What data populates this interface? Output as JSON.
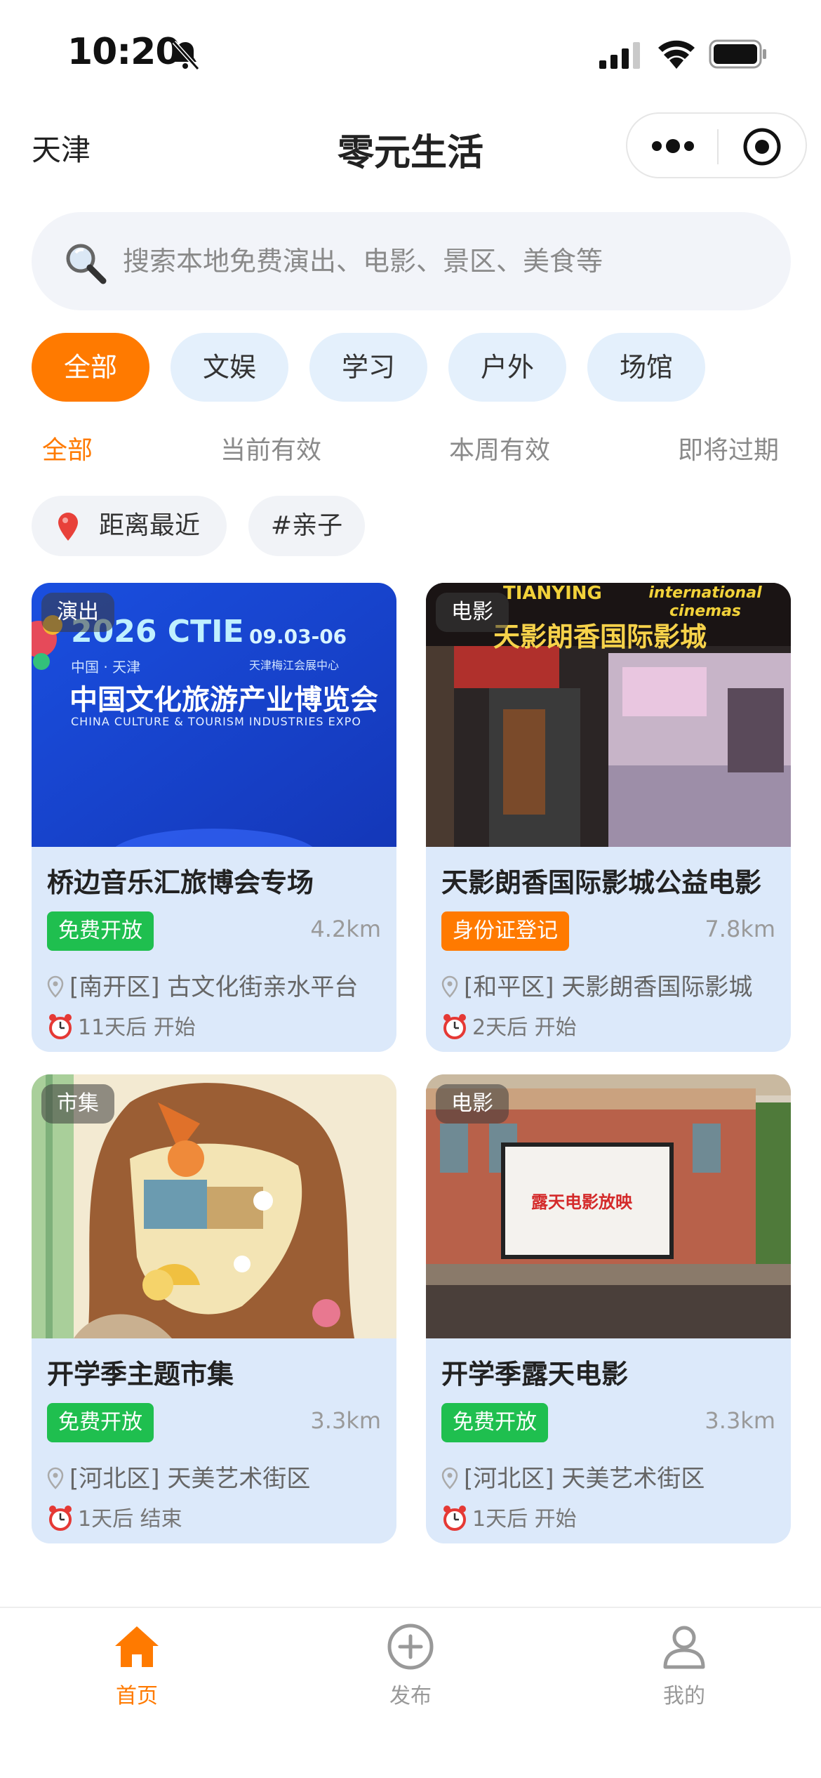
{
  "status_bar": {
    "time": "10:20"
  },
  "nav": {
    "city": "天津",
    "title": "零元生活"
  },
  "search": {
    "placeholder": "搜索本地免费演出、电影、景区、美食等"
  },
  "categories": [
    "全部",
    "文娱",
    "学习",
    "户外",
    "场馆"
  ],
  "time_filters": [
    "全部",
    "当前有效",
    "本周有效",
    "即将过期"
  ],
  "tags": {
    "nearest": "距离最近",
    "family": "#亲子"
  },
  "cards": [
    {
      "badge": "演出",
      "title": "桥边音乐汇旅博会专场",
      "pill": "免费开放",
      "pill_color": "#1fbf4f",
      "distance": "4.2km",
      "location": "[南开区] 古文化街亲水平台",
      "time": "11天后 开始",
      "image": {
        "year_text": "2026 CTIE",
        "date_text": "09.03-06",
        "sub_text": "中国 · 天津",
        "venue_text": "天津梅江会展中心",
        "cn_title": "中国文化旅游产业博览会",
        "en_title": "CHINA CULTURE & TOURISM INDUSTRIES EXPO"
      }
    },
    {
      "badge": "电影",
      "title": "天影朗香国际影城公益电影",
      "pill": "身份证登记",
      "pill_color": "#ff7a00",
      "distance": "7.8km",
      "location": "[和平区] 天影朗香国际影城",
      "time": "2天后 开始",
      "image": {
        "brand_en": "TIANYING",
        "brand_en2": "international cinemas",
        "sign_cn": "天影朗香国际影城"
      }
    },
    {
      "badge": "市集",
      "title": "开学季主题市集",
      "pill": "免费开放",
      "pill_color": "#1fbf4f",
      "distance": "3.3km",
      "location": "[河北区] 天美艺术街区",
      "time": "1天后 结束"
    },
    {
      "badge": "电影",
      "title": "开学季露天电影",
      "pill": "免费开放",
      "pill_color": "#1fbf4f",
      "distance": "3.3km",
      "location": "[河北区] 天美艺术街区",
      "time": "1天后 开始",
      "image": {
        "screen_text": "露天电影放映"
      }
    }
  ],
  "tabbar": [
    {
      "label": "首页",
      "icon": "home-icon",
      "active": true
    },
    {
      "label": "发布",
      "icon": "plus-circle-icon",
      "active": false
    },
    {
      "label": "我的",
      "icon": "user-icon",
      "active": false
    }
  ],
  "colors": {
    "accent": "#ff7a00",
    "chip_bg": "#e4f0fc",
    "card_bg": "#dce9fa",
    "green": "#1fbf4f"
  }
}
